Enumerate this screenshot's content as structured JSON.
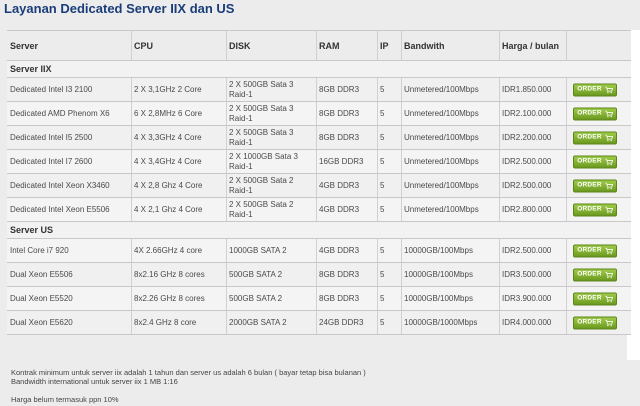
{
  "page": {
    "title": "Layanan Dedicated Server IIX dan US"
  },
  "table": {
    "headers": [
      "Server",
      "CPU",
      "DISK",
      "RAM",
      "IP",
      "Bandwith",
      "Harga / bulan"
    ],
    "order_label": "ORDER",
    "sections": [
      {
        "title": "Server IIX",
        "rows": [
          [
            "Dedicated Intel I3 2100",
            "2 X 3,1GHz 2 Core",
            "2 X 500GB Sata 3\nRaid-1",
            "8GB DDR3",
            "5",
            "Unmetered/100Mbps",
            "IDR1.850.000"
          ],
          [
            "Dedicated AMD Phenom X6",
            "6 X 2,8MHz 6 Core",
            "2 X 500GB Sata 3\nRaid-1",
            "8GB DDR3",
            "5",
            "Unmetered/100Mbps",
            "IDR2.100.000"
          ],
          [
            "Dedicated Intel I5 2500",
            "4 X 3,3GHz 4 Core",
            "2 X 500GB Sata 3\nRaid-1",
            "8GB DDR3",
            "5",
            "Unmetered/100Mbps",
            "IDR2.200.000"
          ],
          [
            "Dedicated Intel I7 2600",
            "4 X 3,4GHz 4 Core",
            "2 X 1000GB Sata 3\nRaid-1",
            "16GB DDR3",
            "5",
            "Unmetered/100Mbps",
            "IDR2.500.000"
          ],
          [
            "Dedicated Intel Xeon X3460",
            "4 X 2,8 Ghz 4 Core",
            "2 X 500GB Sata 2\nRaid-1",
            "4GB DDR3",
            "5",
            "Unmetered/100Mbps",
            "IDR2.500.000"
          ],
          [
            "Dedicated Intel Xeon E5506",
            "4 X 2,1 Ghz 4 Core",
            "2 X 500GB Sata 2\nRaid-1",
            "4GB DDR3",
            "5",
            "Unmetered/100Mbps",
            "IDR2.800.000"
          ]
        ]
      },
      {
        "title": "Server US",
        "rows": [
          [
            "Intel Core i7 920",
            "4X 2.66GHz 4 core",
            "1000GB SATA 2",
            "4GB DDR3",
            "5",
            "10000GB/100Mbps",
            "IDR2.500.000"
          ],
          [
            "Dual Xeon E5506",
            "8x2.16 GHz 8 cores",
            "500GB SATA 2",
            "8GB DDR3",
            "5",
            "10000GB/100Mbps",
            "IDR3.500.000"
          ],
          [
            "Dual Xeon E5520",
            "8x2.26 GHz 8 cores",
            "500GB SATA 2",
            "8GB DDR3",
            "5",
            "10000GB/100Mbps",
            "IDR3.900.000"
          ],
          [
            "Dual Xeon E5620",
            "8x2.4 GHz 8 core",
            "2000GB SATA 2",
            "24GB DDR3",
            "5",
            "10000GB/1000Mbps",
            "IDR4.000.000"
          ]
        ]
      }
    ]
  },
  "notes": [
    "Kontrak minimum untuk server iix adalah 1 tahun dan server us adalah 6 bulan ( bayar tetap bisa bulanan )",
    "Bandwidth international untuk server iix 1 MB 1:16",
    "Harga belum termasuk ppn 10%"
  ],
  "colors": {
    "title": "#1a3d7a",
    "order_button": "#7fb02c",
    "background": "#ececec"
  },
  "icons": {
    "order_button": "cart-icon"
  }
}
